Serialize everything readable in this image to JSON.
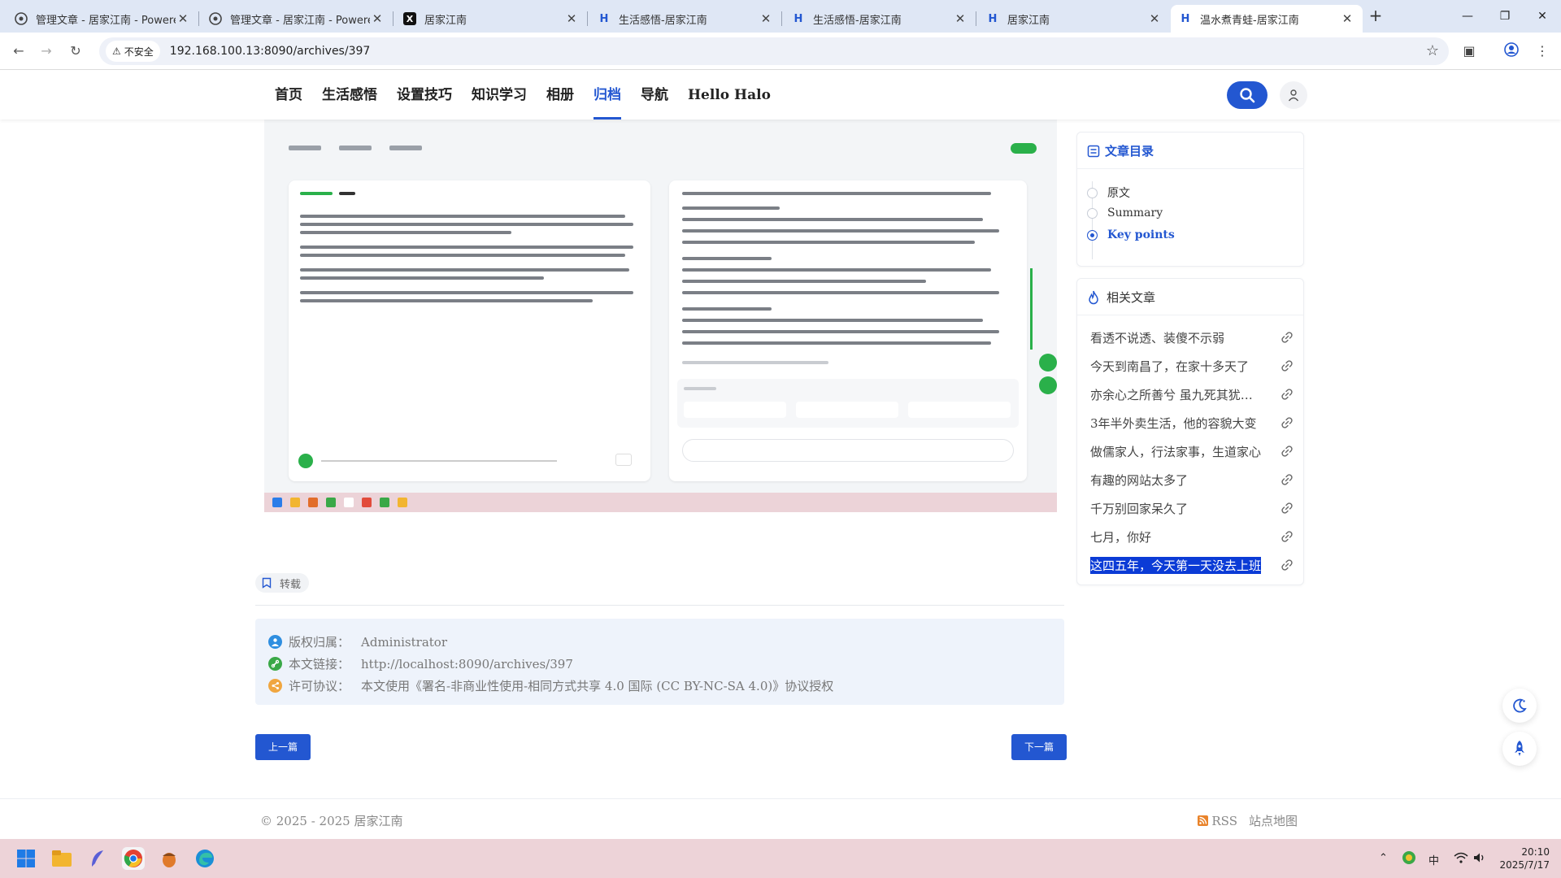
{
  "browser": {
    "tabs": [
      {
        "title": "管理文章 - 居家江南 - Powered",
        "icon": "halo-icon"
      },
      {
        "title": "管理文章 - 居家江南 - Powered",
        "icon": "halo-icon"
      },
      {
        "title": "居家江南",
        "icon": "x-icon"
      },
      {
        "title": "生活感悟-居家江南",
        "icon": "h-icon"
      },
      {
        "title": "生活感悟-居家江南",
        "icon": "h-icon"
      },
      {
        "title": "居家江南",
        "icon": "h-icon"
      },
      {
        "title": "温水煮青蛙-居家江南",
        "icon": "h-icon",
        "active": true
      }
    ],
    "security_label": "不安全",
    "url": "192.168.100.13:8090/archives/397"
  },
  "nav": {
    "menu": [
      "首页",
      "生活感悟",
      "设置技巧",
      "知识学习",
      "相册",
      "归档",
      "导航",
      "Hello Halo"
    ],
    "active_index": 5
  },
  "toc": {
    "title": "文章目录",
    "items": [
      "原文",
      "Summary",
      "Key points"
    ],
    "active_index": 2
  },
  "related": {
    "title": "相关文章",
    "items": [
      "看透不说透、装傻不示弱",
      "今天到南昌了，在家十多天了",
      "亦余心之所善兮 虽九死其犹未悔",
      "3年半外卖生活，他的容貌大变",
      "做儒家人，行法家事，生道家心",
      "有趣的网站太多了",
      "千万别回家呆久了",
      "七月，你好",
      "这四五年，今天第一天没去上班"
    ],
    "selected_index": 8
  },
  "article": {
    "tag": "转载",
    "copyright": {
      "owner_label": "版权归属：",
      "owner": "Administrator",
      "link_label": "本文链接：",
      "link": "http://localhost:8090/archives/397",
      "license_label": "许可协议：",
      "license": "本文使用《署名-非商业性使用-相同方式共享 4.0 国际 (CC BY-NC-SA 4.0)》协议授权"
    },
    "prev_label": "上一篇",
    "next_label": "下一篇"
  },
  "footer": {
    "copyright": "© 2025 - 2025  居家江南",
    "rss": "RSS",
    "sitemap": "站点地图"
  },
  "taskbar": {
    "ime": "中",
    "time": "20:10",
    "date": "2025/7/17"
  },
  "colors": {
    "accent": "#2357d1",
    "green": "#2ab04a",
    "taskbar": "#edd3d8"
  }
}
